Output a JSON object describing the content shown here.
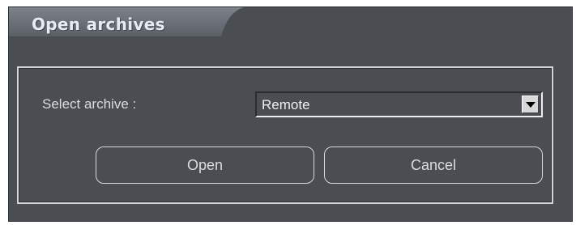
{
  "dialog": {
    "title": "Open archives"
  },
  "form": {
    "select_label": "Select archive :",
    "select_value": "Remote"
  },
  "buttons": {
    "open_label": "Open",
    "cancel_label": "Cancel"
  },
  "icons": {
    "dropdown": "chevron-down-icon"
  },
  "colors": {
    "background": "#4a4e53",
    "title_tab": "#6b7077",
    "text": "#dcdcdc",
    "border": "#d4d4d4"
  }
}
